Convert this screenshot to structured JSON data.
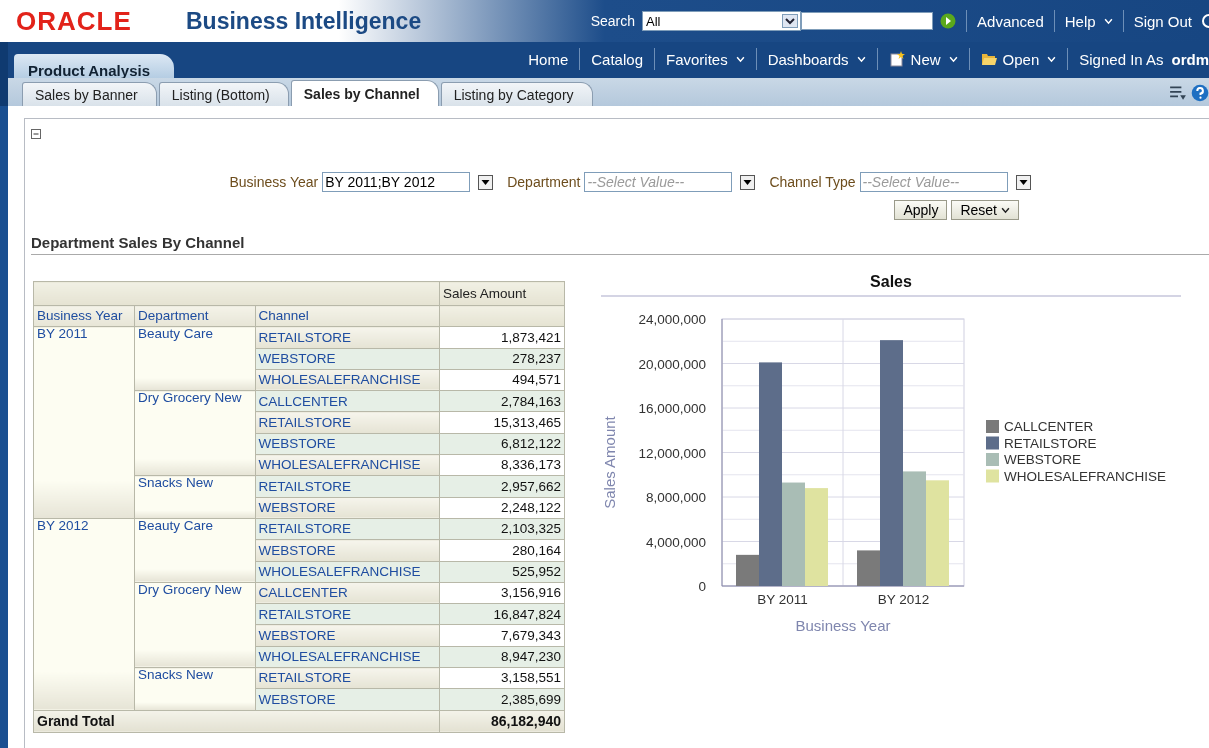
{
  "header": {
    "logo": "ORACLE",
    "product": "Business Intelligence",
    "search_label": "Search",
    "search_scope": "All",
    "links": [
      {
        "label": "Advanced",
        "menu": false
      },
      {
        "label": "Help",
        "menu": true
      },
      {
        "label": "Sign Out",
        "menu": false
      }
    ]
  },
  "nav": {
    "dashboard": "Product Analysis",
    "items": [
      {
        "label": "Home",
        "menu": false,
        "kind": "plain"
      },
      {
        "label": "Catalog",
        "menu": false,
        "kind": "plain"
      },
      {
        "label": "Favorites",
        "menu": true,
        "kind": "plain"
      },
      {
        "label": "Dashboards",
        "menu": true,
        "kind": "plain"
      },
      {
        "label": "New",
        "menu": true,
        "kind": "new"
      },
      {
        "label": "Open",
        "menu": true,
        "kind": "open"
      }
    ],
    "signed_in_label": "Signed In As",
    "user": "ordm"
  },
  "tabs": [
    {
      "label": "Sales by Banner",
      "selected": false
    },
    {
      "label": "Listing (Bottom)",
      "selected": false
    },
    {
      "label": "Sales by Channel",
      "selected": true
    },
    {
      "label": "Listing by Category",
      "selected": false
    }
  ],
  "prompts": [
    {
      "label": "Business Year",
      "value": "BY 2011;BY 2012"
    },
    {
      "label": "Department",
      "placeholder": "--Select Value--"
    },
    {
      "label": "Channel Type",
      "placeholder": "--Select Value--"
    }
  ],
  "buttons": {
    "apply": "Apply",
    "reset": "Reset"
  },
  "section_title": "Department Sales By Channel",
  "table": {
    "measure": "Sales Amount",
    "columns": [
      "Business Year",
      "Department",
      "Channel"
    ],
    "rows": [
      {
        "label": "BY 2011",
        "children": [
          {
            "label": "Beauty Care",
            "children": [
              {
                "label": "RETAILSTORE",
                "value": "1,873,421"
              },
              {
                "label": "WEBSTORE",
                "value": "278,237"
              },
              {
                "label": "WHOLESALEFRANCHISE",
                "value": "494,571"
              }
            ]
          },
          {
            "label": "Dry Grocery New",
            "children": [
              {
                "label": "CALLCENTER",
                "value": "2,784,163"
              },
              {
                "label": "RETAILSTORE",
                "value": "15,313,465"
              },
              {
                "label": "WEBSTORE",
                "value": "6,812,122"
              },
              {
                "label": "WHOLESALEFRANCHISE",
                "value": "8,336,173"
              }
            ]
          },
          {
            "label": "Snacks New",
            "children": [
              {
                "label": "RETAILSTORE",
                "value": "2,957,662"
              },
              {
                "label": "WEBSTORE",
                "value": "2,248,122"
              }
            ]
          }
        ]
      },
      {
        "label": "BY 2012",
        "children": [
          {
            "label": "Beauty Care",
            "children": [
              {
                "label": "RETAILSTORE",
                "value": "2,103,325"
              },
              {
                "label": "WEBSTORE",
                "value": "280,164"
              },
              {
                "label": "WHOLESALEFRANCHISE",
                "value": "525,952"
              }
            ]
          },
          {
            "label": "Dry Grocery New",
            "children": [
              {
                "label": "CALLCENTER",
                "value": "3,156,916"
              },
              {
                "label": "RETAILSTORE",
                "value": "16,847,824"
              },
              {
                "label": "WEBSTORE",
                "value": "7,679,343"
              },
              {
                "label": "WHOLESALEFRANCHISE",
                "value": "8,947,230"
              }
            ]
          },
          {
            "label": "Snacks New",
            "children": [
              {
                "label": "RETAILSTORE",
                "value": "3,158,551"
              },
              {
                "label": "WEBSTORE",
                "value": "2,385,699"
              }
            ]
          }
        ]
      }
    ],
    "grand_total_label": "Grand Total",
    "grand_total": "86,182,940"
  },
  "chart": {
    "chart_data": {
      "type": "bar",
      "title": "Sales",
      "xlabel": "Business Year",
      "ylabel": "Sales Amount",
      "categories": [
        "BY 2011",
        "BY 2012"
      ],
      "series": [
        {
          "name": "CALLCENTER",
          "color": "#7a7a7a",
          "values": [
            2800000,
            3200000
          ]
        },
        {
          "name": "RETAILSTORE",
          "color": "#5d6d8a",
          "values": [
            20100000,
            22100000
          ]
        },
        {
          "name": "WEBSTORE",
          "color": "#a9bdb5",
          "values": [
            9300000,
            10300000
          ]
        },
        {
          "name": "WHOLESALEFRANCHISE",
          "color": "#dfe3a0",
          "values": [
            8800000,
            9500000
          ]
        }
      ],
      "grid": true,
      "legend": true,
      "ylim": [
        0,
        24000000
      ],
      "yticks": [
        {
          "value": 0,
          "label": "0"
        },
        {
          "value": 4000000,
          "label": "4,000,000"
        },
        {
          "value": 8000000,
          "label": "8,000,000"
        },
        {
          "value": 12000000,
          "label": "12,000,000"
        },
        {
          "value": 16000000,
          "label": "16,000,000"
        },
        {
          "value": 20000000,
          "label": "20,000,000"
        },
        {
          "value": 24000000,
          "label": "24,000,000"
        }
      ]
    }
  }
}
